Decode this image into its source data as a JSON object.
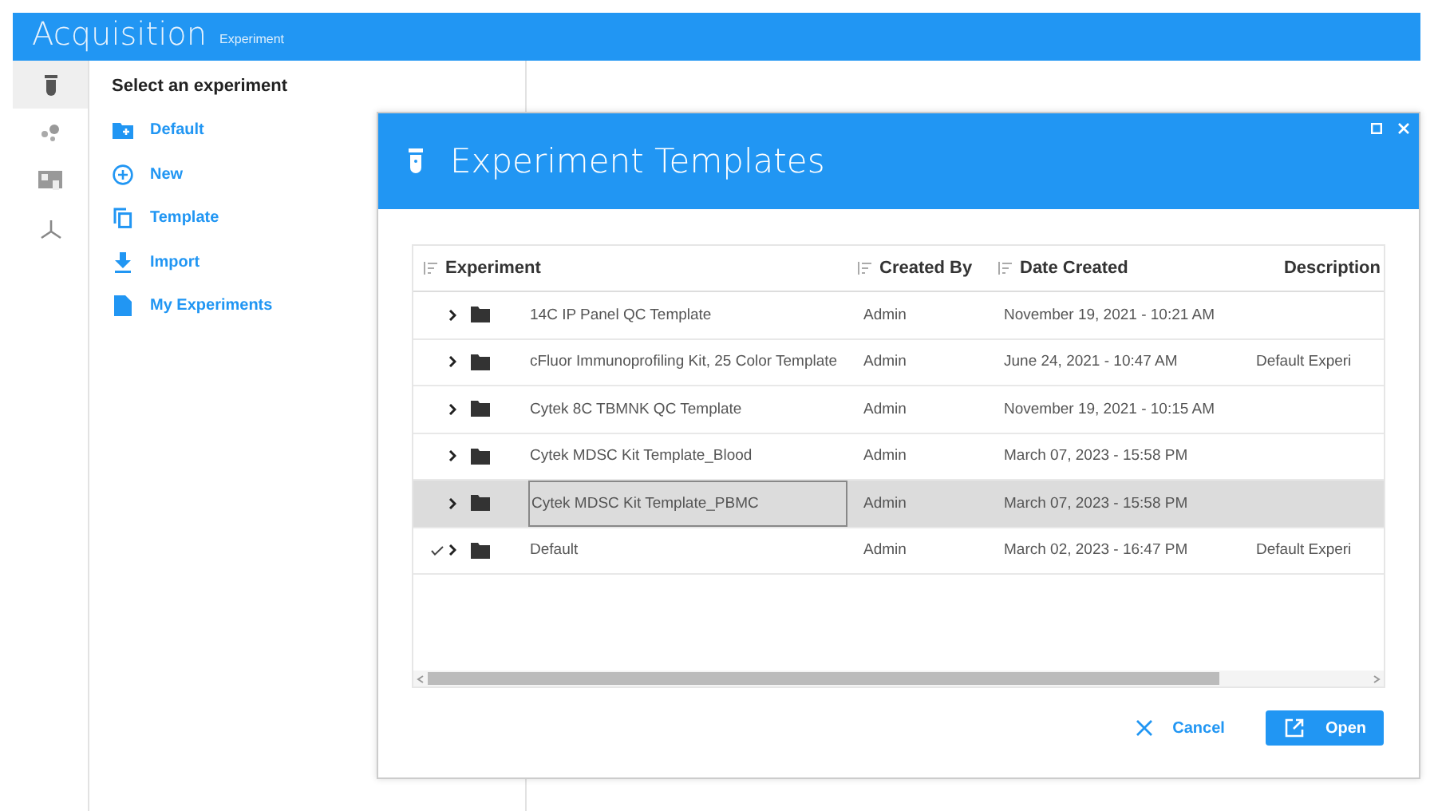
{
  "app": {
    "title": "Acquisition",
    "subtitle": "Experiment"
  },
  "sidebar": {
    "items": [
      {
        "kind": "tube",
        "selected": true
      },
      {
        "kind": "dots",
        "selected": false
      },
      {
        "kind": "plate",
        "selected": false
      },
      {
        "kind": "axes",
        "selected": false
      }
    ]
  },
  "panel": {
    "heading": "Select an experiment",
    "items": [
      {
        "kind": "folder-plus",
        "label": "Default"
      },
      {
        "kind": "plus-circle",
        "label": "New"
      },
      {
        "kind": "copy",
        "label": "Template"
      },
      {
        "kind": "download",
        "label": "Import"
      },
      {
        "kind": "file",
        "label": "My Experiments"
      }
    ]
  },
  "dialog": {
    "title": "Experiment Templates",
    "table": {
      "columns": [
        {
          "label": "Experiment",
          "sortable": true
        },
        {
          "label": "Created By",
          "sortable": true
        },
        {
          "label": "Date Created",
          "sortable": true
        },
        {
          "label": "Description",
          "sortable": false
        }
      ],
      "rows": [
        {
          "name": "14C IP Panel QC Template",
          "created_by": "Admin",
          "date": "November 19, 2021 - 10:21 AM",
          "selected": false,
          "checked": false
        },
        {
          "name": "cFluor Immunoprofiling Kit, 25 Color Template",
          "created_by": "Admin",
          "date": "June 24, 2021 - 10:47 AM",
          "description": "Default Experi",
          "selected": false,
          "checked": false
        },
        {
          "name": "Cytek 8C TBMNK QC Template",
          "created_by": "Admin",
          "date": "November 19, 2021 - 10:15 AM",
          "selected": false,
          "checked": false
        },
        {
          "name": "Cytek MDSC Kit Template_Blood",
          "created_by": "Admin",
          "date": "March 07, 2023 - 15:58 PM",
          "selected": false,
          "checked": false
        },
        {
          "name": "Cytek MDSC Kit Template_PBMC",
          "created_by": "Admin",
          "date": "March 07, 2023 - 15:58 PM",
          "selected": true,
          "checked": false
        },
        {
          "name": "Default",
          "created_by": "Admin",
          "date": "March 02, 2023 - 16:47 PM",
          "description": "Default Experi",
          "selected": false,
          "checked": true
        }
      ]
    },
    "buttons": [
      {
        "kind": "cancel",
        "label": "Cancel"
      },
      {
        "kind": "open",
        "label": "Open"
      }
    ]
  }
}
